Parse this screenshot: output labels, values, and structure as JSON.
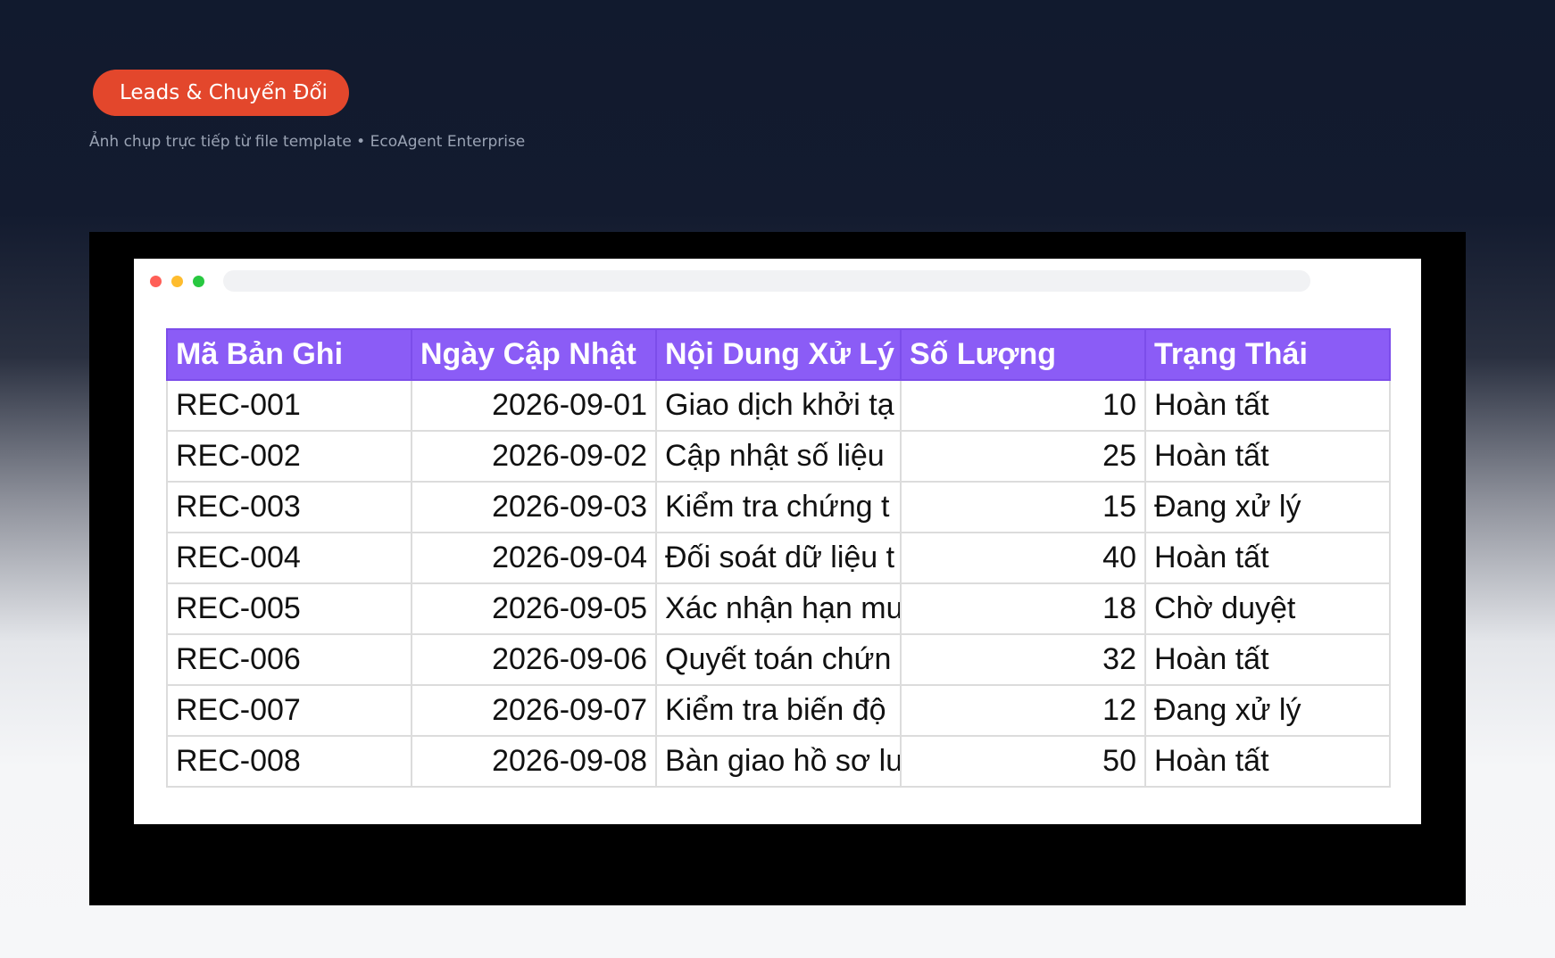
{
  "header": {
    "badge_icon": "",
    "badge_label": "Leads & Chuyển Đổi",
    "subtitle": "Ảnh chụp trực tiếp từ file template • EcoAgent Enterprise",
    "badge_color": "#e3472c"
  },
  "table": {
    "header_color": "#8b5cf6",
    "columns": [
      "Mã Bản Ghi",
      "Ngày Cập Nhật",
      "Nội Dung Xử Lý",
      "Số Lượng",
      "Trạng Thái"
    ],
    "rows": [
      [
        "REC-001",
        "2026-09-01",
        "Giao dịch khởi tạ",
        "10",
        "Hoàn tất"
      ],
      [
        "REC-002",
        "2026-09-02",
        "Cập nhật số liệu",
        "25",
        "Hoàn tất"
      ],
      [
        "REC-003",
        "2026-09-03",
        "Kiểm tra chứng t",
        "15",
        "Đang xử lý"
      ],
      [
        "REC-004",
        "2026-09-04",
        "Đối soát dữ liệu t",
        "40",
        "Hoàn tất"
      ],
      [
        "REC-005",
        "2026-09-05",
        "Xác nhận hạn mư",
        "18",
        "Chờ duyệt"
      ],
      [
        "REC-006",
        "2026-09-06",
        "Quyết toán chứn",
        "32",
        "Hoàn tất"
      ],
      [
        "REC-007",
        "2026-09-07",
        "Kiểm tra biến độ",
        "12",
        "Đang xử lý"
      ],
      [
        "REC-008",
        "2026-09-08",
        "Bàn giao hồ sơ lư",
        "50",
        "Hoàn tất"
      ]
    ]
  }
}
